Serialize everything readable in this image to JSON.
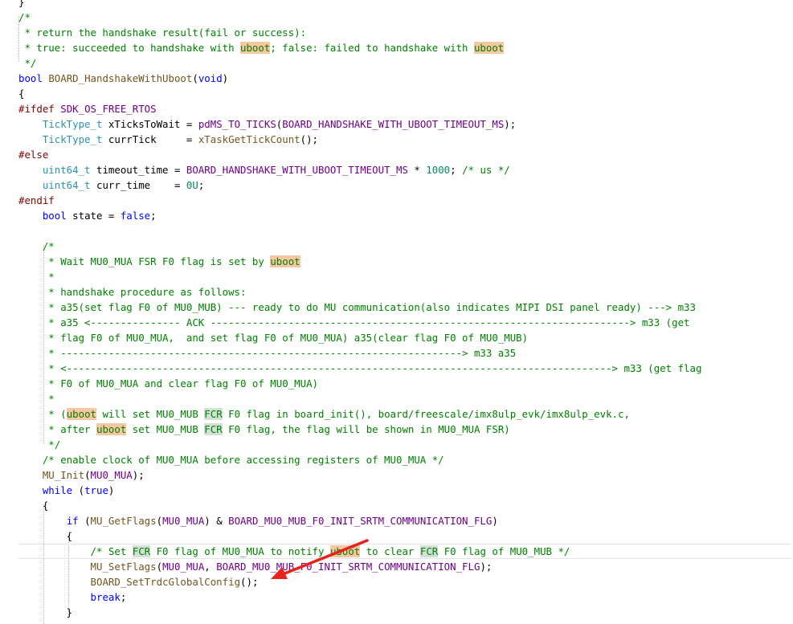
{
  "colors": {
    "comment": "#008000",
    "keyword": "#0000ff",
    "preprocessor": "#800000",
    "macro": "#6f008a",
    "type": "#2b91af",
    "function": "#74531f",
    "number": "#098658",
    "text": "#000000",
    "highlight_word": "#f6c7a2",
    "highlight_fcr": "#d3dfd7",
    "annotation_arrow": "#e8231c"
  },
  "code": {
    "lines": [
      [
        {
          "t": "}",
          "c": "text"
        }
      ],
      [
        {
          "t": "/*",
          "c": "comment"
        }
      ],
      [
        {
          "t": " * return the handshake result(fail or success):",
          "c": "comment"
        }
      ],
      [
        {
          "t": " * true: succeeded to handshake with ",
          "c": "comment"
        },
        {
          "t": "uboot",
          "c": "comment",
          "h": "highlight_word"
        },
        {
          "t": "; false: failed to handshake with ",
          "c": "comment"
        },
        {
          "t": "uboot",
          "c": "comment",
          "h": "highlight_word"
        }
      ],
      [
        {
          "t": " */",
          "c": "comment"
        }
      ],
      [
        {
          "t": "bool",
          "c": "keyword"
        },
        {
          "t": " ",
          "c": "text"
        },
        {
          "t": "BOARD_HandshakeWithUboot",
          "c": "function"
        },
        {
          "t": "(",
          "c": "text"
        },
        {
          "t": "void",
          "c": "keyword"
        },
        {
          "t": ")",
          "c": "text"
        }
      ],
      [
        {
          "t": "{",
          "c": "text"
        }
      ],
      [
        {
          "t": "#ifdef",
          "c": "preprocessor"
        },
        {
          "t": " ",
          "c": "text"
        },
        {
          "t": "SDK_OS_FREE_RTOS",
          "c": "macro"
        }
      ],
      [
        {
          "t": "    ",
          "c": "text"
        },
        {
          "t": "TickType_t",
          "c": "type"
        },
        {
          "t": " xTicksToWait = ",
          "c": "text"
        },
        {
          "t": "pdMS_TO_TICKS",
          "c": "macro"
        },
        {
          "t": "(",
          "c": "text"
        },
        {
          "t": "BOARD_HANDSHAKE_WITH_UBOOT_TIMEOUT_MS",
          "c": "macro"
        },
        {
          "t": ");",
          "c": "text"
        }
      ],
      [
        {
          "t": "    ",
          "c": "text"
        },
        {
          "t": "TickType_t",
          "c": "type"
        },
        {
          "t": " currTick     = ",
          "c": "text"
        },
        {
          "t": "xTaskGetTickCount",
          "c": "function"
        },
        {
          "t": "();",
          "c": "text"
        }
      ],
      [
        {
          "t": "#else",
          "c": "preprocessor"
        }
      ],
      [
        {
          "t": "    ",
          "c": "text"
        },
        {
          "t": "uint64_t",
          "c": "type"
        },
        {
          "t": " timeout_time = ",
          "c": "text"
        },
        {
          "t": "BOARD_HANDSHAKE_WITH_UBOOT_TIMEOUT_MS",
          "c": "macro"
        },
        {
          "t": " * ",
          "c": "text"
        },
        {
          "t": "1000",
          "c": "number"
        },
        {
          "t": "; ",
          "c": "text"
        },
        {
          "t": "/* us */",
          "c": "comment"
        }
      ],
      [
        {
          "t": "    ",
          "c": "text"
        },
        {
          "t": "uint64_t",
          "c": "type"
        },
        {
          "t": " curr_time    = ",
          "c": "text"
        },
        {
          "t": "0U",
          "c": "number"
        },
        {
          "t": ";",
          "c": "text"
        }
      ],
      [
        {
          "t": "#endif",
          "c": "preprocessor"
        }
      ],
      [
        {
          "t": "    ",
          "c": "text"
        },
        {
          "t": "bool",
          "c": "keyword"
        },
        {
          "t": " state = ",
          "c": "text"
        },
        {
          "t": "false",
          "c": "keyword"
        },
        {
          "t": ";",
          "c": "text"
        }
      ],
      [
        {
          "t": "",
          "c": "text"
        }
      ],
      [
        {
          "t": "    /*",
          "c": "comment"
        }
      ],
      [
        {
          "t": "     * Wait MU0_MUA FSR F0 flag is set by ",
          "c": "comment"
        },
        {
          "t": "uboot",
          "c": "comment",
          "h": "highlight_word"
        }
      ],
      [
        {
          "t": "     *",
          "c": "comment"
        }
      ],
      [
        {
          "t": "     * handshake procedure as follows:",
          "c": "comment"
        }
      ],
      [
        {
          "t": "     * a35(set flag F0 of MU0_MUB) --- ready to do MU communication(also indicates MIPI DSI panel ready) ---> m33",
          "c": "comment"
        }
      ],
      [
        {
          "t": "     * a35 <--------------- ACK ----------------------------------------------------------------------> m33 (get",
          "c": "comment"
        }
      ],
      [
        {
          "t": "     * flag F0 of MU0_MUA,  and set flag F0 of MU0_MUA) a35(clear flag F0 of MU0_MUB)",
          "c": "comment"
        }
      ],
      [
        {
          "t": "     * -------------------------------------------------------------------> m33 a35",
          "c": "comment"
        }
      ],
      [
        {
          "t": "     * <-------------------------------------------------------------------------------------------> m33 (get flag",
          "c": "comment"
        }
      ],
      [
        {
          "t": "     * F0 of MU0_MUA and clear flag F0 of MU0_MUA)",
          "c": "comment"
        }
      ],
      [
        {
          "t": "     *",
          "c": "comment"
        }
      ],
      [
        {
          "t": "     * (",
          "c": "comment"
        },
        {
          "t": "uboot",
          "c": "comment",
          "h": "highlight_word"
        },
        {
          "t": " will set MU0_MUB ",
          "c": "comment"
        },
        {
          "t": "FCR",
          "c": "comment",
          "h": "highlight_fcr"
        },
        {
          "t": " F0 flag in board_init(), board/freescale/imx8ulp_evk/imx8ulp_evk.c,",
          "c": "comment"
        }
      ],
      [
        {
          "t": "     * after ",
          "c": "comment"
        },
        {
          "t": "uboot",
          "c": "comment",
          "h": "highlight_word"
        },
        {
          "t": " set MU0_MUB ",
          "c": "comment"
        },
        {
          "t": "FCR",
          "c": "comment",
          "h": "highlight_fcr"
        },
        {
          "t": " F0 flag, the flag will be shown in MU0_MUA FSR)",
          "c": "comment"
        }
      ],
      [
        {
          "t": "     */",
          "c": "comment"
        }
      ],
      [
        {
          "t": "    /* enable clock of MU0_MUA before accessing registers of MU0_MUA */",
          "c": "comment"
        }
      ],
      [
        {
          "t": "    ",
          "c": "text"
        },
        {
          "t": "MU_Init",
          "c": "function"
        },
        {
          "t": "(",
          "c": "text"
        },
        {
          "t": "MU0_MUA",
          "c": "macro"
        },
        {
          "t": ");",
          "c": "text"
        }
      ],
      [
        {
          "t": "    ",
          "c": "text"
        },
        {
          "t": "while",
          "c": "keyword"
        },
        {
          "t": " (",
          "c": "text"
        },
        {
          "t": "true",
          "c": "keyword"
        },
        {
          "t": ")",
          "c": "text"
        }
      ],
      [
        {
          "t": "    {",
          "c": "text"
        }
      ],
      [
        {
          "t": "        ",
          "c": "text"
        },
        {
          "t": "if",
          "c": "keyword"
        },
        {
          "t": " (",
          "c": "text"
        },
        {
          "t": "MU_GetFlags",
          "c": "function"
        },
        {
          "t": "(",
          "c": "text"
        },
        {
          "t": "MU0_MUA",
          "c": "macro"
        },
        {
          "t": ") & ",
          "c": "text"
        },
        {
          "t": "BOARD_MU0_MUB_F0_INIT_SRTM_COMMUNICATION_FLG",
          "c": "macro"
        },
        {
          "t": ")",
          "c": "text"
        }
      ],
      [
        {
          "t": "        {",
          "c": "text"
        }
      ],
      [
        {
          "t": "            /* Set ",
          "c": "comment"
        },
        {
          "t": "FCR",
          "c": "comment",
          "h": "highlight_fcr"
        },
        {
          "t": " F0 flag of MU0_MUA to notify ",
          "c": "comment"
        },
        {
          "t": "uboot",
          "c": "comment",
          "h": "highlight_word"
        },
        {
          "t": " to clear ",
          "c": "comment"
        },
        {
          "t": "FCR",
          "c": "comment",
          "h": "highlight_fcr"
        },
        {
          "t": " F0 flag of MU0_MUB */",
          "c": "comment"
        }
      ],
      [
        {
          "t": "            ",
          "c": "text"
        },
        {
          "t": "MU_SetFlags",
          "c": "function"
        },
        {
          "t": "(",
          "c": "text"
        },
        {
          "t": "MU0_MUA",
          "c": "macro"
        },
        {
          "t": ", ",
          "c": "text"
        },
        {
          "t": "BOARD_MU0_MUB_F0_INIT_SRTM_COMMUNICATION_FLG",
          "c": "macro"
        },
        {
          "t": ");",
          "c": "text"
        }
      ],
      [
        {
          "t": "            ",
          "c": "text"
        },
        {
          "t": "BOARD_SetTrdcGlobalConfig",
          "c": "function"
        },
        {
          "t": "();",
          "c": "text"
        }
      ],
      [
        {
          "t": "            ",
          "c": "text"
        },
        {
          "t": "break",
          "c": "keyword"
        },
        {
          "t": ";",
          "c": "text"
        }
      ],
      [
        {
          "t": "        }",
          "c": "text"
        }
      ]
    ]
  }
}
